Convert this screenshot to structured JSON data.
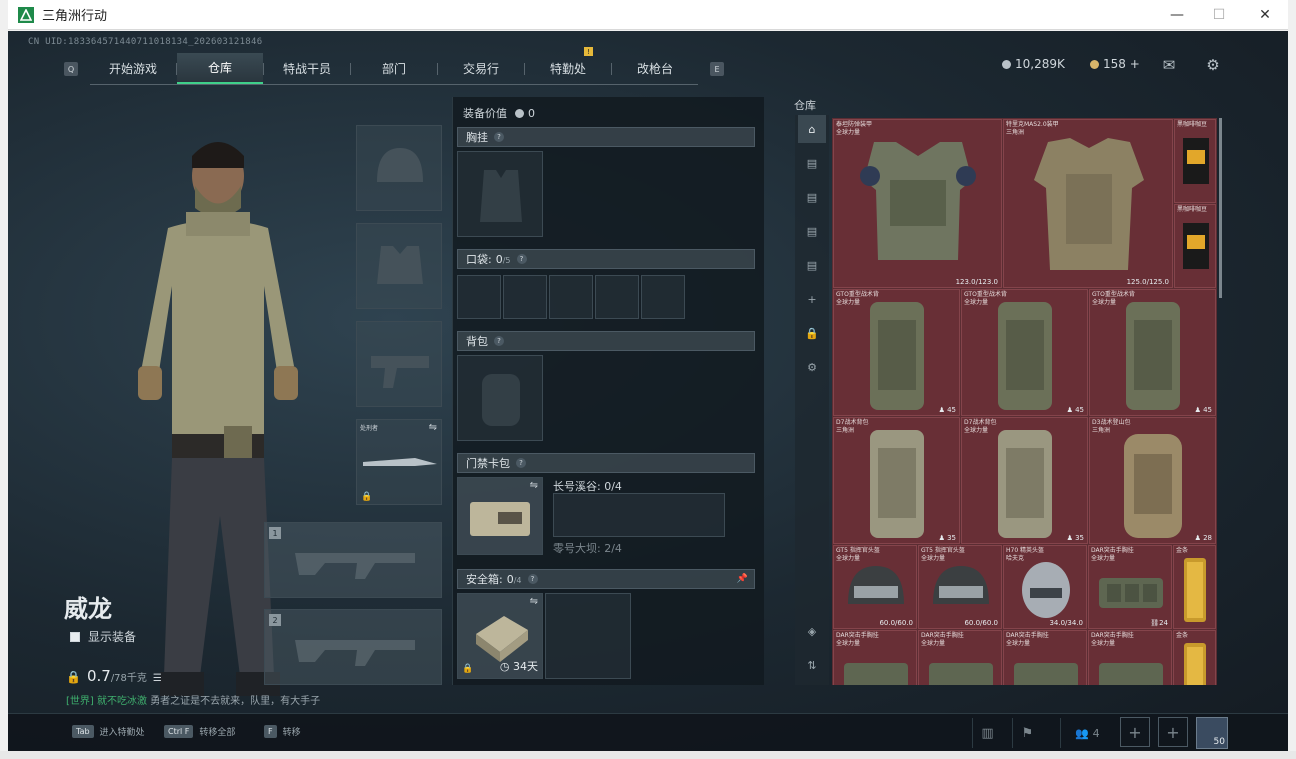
{
  "window": {
    "title": "三角洲行动",
    "controls": [
      "—",
      "☐",
      "✕"
    ]
  },
  "header": {
    "cn_uid": "CN UID:1833645714407110181​34_202603121846",
    "nav_key_left": "Q",
    "nav_key_right": "E",
    "tabs": [
      "开始游戏",
      "仓库",
      "特战干员",
      "部门",
      "交易行",
      "特勤处",
      "改枪台"
    ],
    "active_tab": "仓库",
    "badge": "!",
    "currency_1": "10,289K",
    "currency_2": "158 +"
  },
  "character": {
    "name": "威龙",
    "show_equip": "显示装备",
    "weight_value": "0.7",
    "weight_max": "/78千克",
    "melee_label": "处刑者",
    "weapon_slot_1": "1",
    "weapon_slot_2": "2"
  },
  "chat": {
    "channel": "[世界]",
    "user": "就不吃冰激",
    "message": "勇者之证是不去就来，队里，有大手子"
  },
  "loadout": {
    "value_label": "装备价值",
    "value": "0",
    "chest_rig": "胸挂",
    "pockets": "口袋:",
    "pockets_count": "0",
    "pockets_max": "/5",
    "backpack": "背包",
    "keycard": "门禁卡包",
    "key_1": "长号溪谷: 0/4",
    "key_2": "零号大坝: 2/4",
    "safe_box": "安全箱:",
    "safe_count": "0",
    "safe_max": "/4",
    "safe_days": "34天"
  },
  "storage": {
    "title": "仓库",
    "items": [
      {
        "name": "泰坦防弹装甲",
        "sub": "全球力量",
        "stat": "123.0/123.0"
      },
      {
        "name": "特里克MAS2.0装甲",
        "sub": "三角洲",
        "stat": "125.0/125.0"
      },
      {
        "name": "黑咖啡咖豆",
        "sub": "",
        "stat": ""
      },
      {
        "name": "黑咖啡咖豆",
        "sub": "",
        "stat": ""
      },
      {
        "name": "GTO重型战术背",
        "sub": "全球力量",
        "stat": "45"
      },
      {
        "name": "GTO重型战术背",
        "sub": "全球力量",
        "stat": "45"
      },
      {
        "name": "GTO重型战术背",
        "sub": "全球力量",
        "stat": "45"
      },
      {
        "name": "D7战术背包",
        "sub": "三角洲",
        "stat": "35"
      },
      {
        "name": "D7战术背包",
        "sub": "全球力量",
        "stat": "35"
      },
      {
        "name": "D3战术登山包",
        "sub": "三角洲",
        "stat": "28"
      },
      {
        "name": "GT5 指挥官头盔",
        "sub": "全球力量",
        "stat": "60.0/60.0"
      },
      {
        "name": "GT5 指挥官头盔",
        "sub": "全球力量",
        "stat": "60.0/60.0"
      },
      {
        "name": "H70 精英头盔",
        "sub": "哈夫克",
        "stat": "34.0/34.0"
      },
      {
        "name": "DAR突击手胸挂",
        "sub": "全球力量",
        "stat": "24"
      },
      {
        "name": "金条",
        "sub": "",
        "stat": ""
      },
      {
        "name": "DAR突击手胸挂",
        "sub": "全球力量",
        "stat": ""
      },
      {
        "name": "DAR突击手胸挂",
        "sub": "全球力量",
        "stat": ""
      },
      {
        "name": "DAR突击手胸挂",
        "sub": "全球力量",
        "stat": ""
      },
      {
        "name": "DAR突击手胸挂",
        "sub": "全球力量",
        "stat": ""
      },
      {
        "name": "金条",
        "sub": "",
        "stat": ""
      }
    ]
  },
  "bottom": {
    "hint_1_key": "Tab",
    "hint_1": "进入特勤处",
    "hint_2_key": "Ctrl F",
    "hint_2": "转移全部",
    "hint_3_key": "F",
    "hint_3": "转移",
    "friends": "4",
    "level": "50"
  },
  "colors": {
    "accent": "#3fd08a",
    "storage_bg": "#5b2d33",
    "badge": "#e6b93a"
  }
}
